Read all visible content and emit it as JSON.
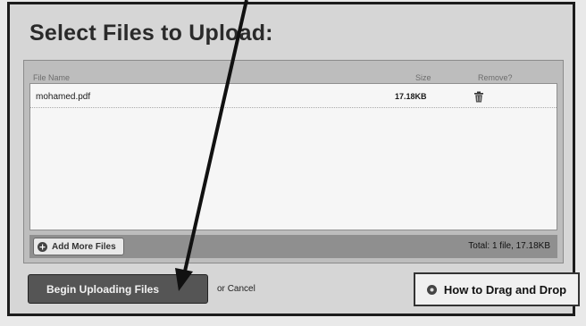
{
  "title": "Select Files to Upload:",
  "columns": {
    "file_name": "File Name",
    "size": "Size",
    "remove": "Remove?"
  },
  "files": [
    {
      "name": "mohamed.pdf",
      "size": "17.18KB",
      "remove_icon": "trash-icon"
    }
  ],
  "add_more": {
    "label": "Add More Files",
    "icon": "plus-circle-icon"
  },
  "total": "Total: 1 file, 17.18KB",
  "begin_upload": {
    "label": "Begin Uploading Files"
  },
  "or_text": "or",
  "cancel_label": "Cancel",
  "how_to": {
    "label": "How to Drag and Drop",
    "icon": "info-circle-icon"
  },
  "colors": {
    "frame": "#1c1c1c",
    "panel": "#bdbdbd",
    "button_dark": "#555555"
  }
}
